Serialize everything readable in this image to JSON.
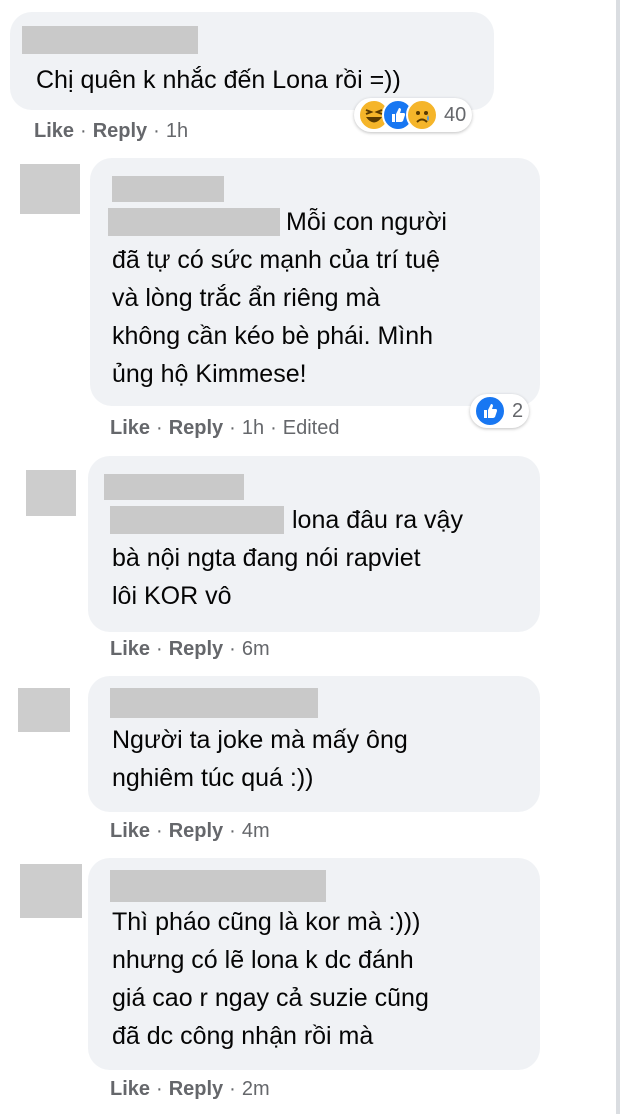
{
  "comments": [
    {
      "lines": [
        "Chị quên k nhắc đến Lona rồi =))"
      ],
      "reactions": {
        "icons": [
          "haha-icon",
          "like-icon",
          "sad-icon"
        ],
        "count": "40"
      },
      "actions": {
        "like": "Like",
        "reply": "Reply",
        "time": "1h",
        "edited": ""
      }
    },
    {
      "lines": [
        "Mỗi con người",
        "đã tự có sức mạnh của trí tuệ",
        "và lòng trắc ẩn riêng mà",
        "không cần kéo bè phái. Mình",
        "ủng hộ Kimmese!"
      ],
      "reactions": {
        "icons": [
          "like-icon"
        ],
        "count": "2"
      },
      "actions": {
        "like": "Like",
        "reply": "Reply",
        "time": "1h",
        "edited": "Edited"
      }
    },
    {
      "lines": [
        "lona đâu ra vậy",
        "bà nội ngta đang nói rapviet",
        "lôi KOR vô"
      ],
      "actions": {
        "like": "Like",
        "reply": "Reply",
        "time": "6m",
        "edited": ""
      }
    },
    {
      "lines": [
        "Người ta joke mà mấy ông",
        "nghiêm túc quá :))"
      ],
      "actions": {
        "like": "Like",
        "reply": "Reply",
        "time": "4m",
        "edited": ""
      }
    },
    {
      "lines": [
        "Thì pháo cũng là kor mà :)))",
        "nhưng có lẽ lona k dc đánh",
        "giá cao r ngay cả suzie cũng",
        "đã dc công nhận rồi mà"
      ],
      "actions": {
        "like": "Like",
        "reply": "Reply",
        "time": "2m",
        "edited": ""
      }
    }
  ],
  "colors": {
    "bubble": "#f0f2f5",
    "action_text": "#65676b",
    "like_blue": "#1877f2"
  }
}
